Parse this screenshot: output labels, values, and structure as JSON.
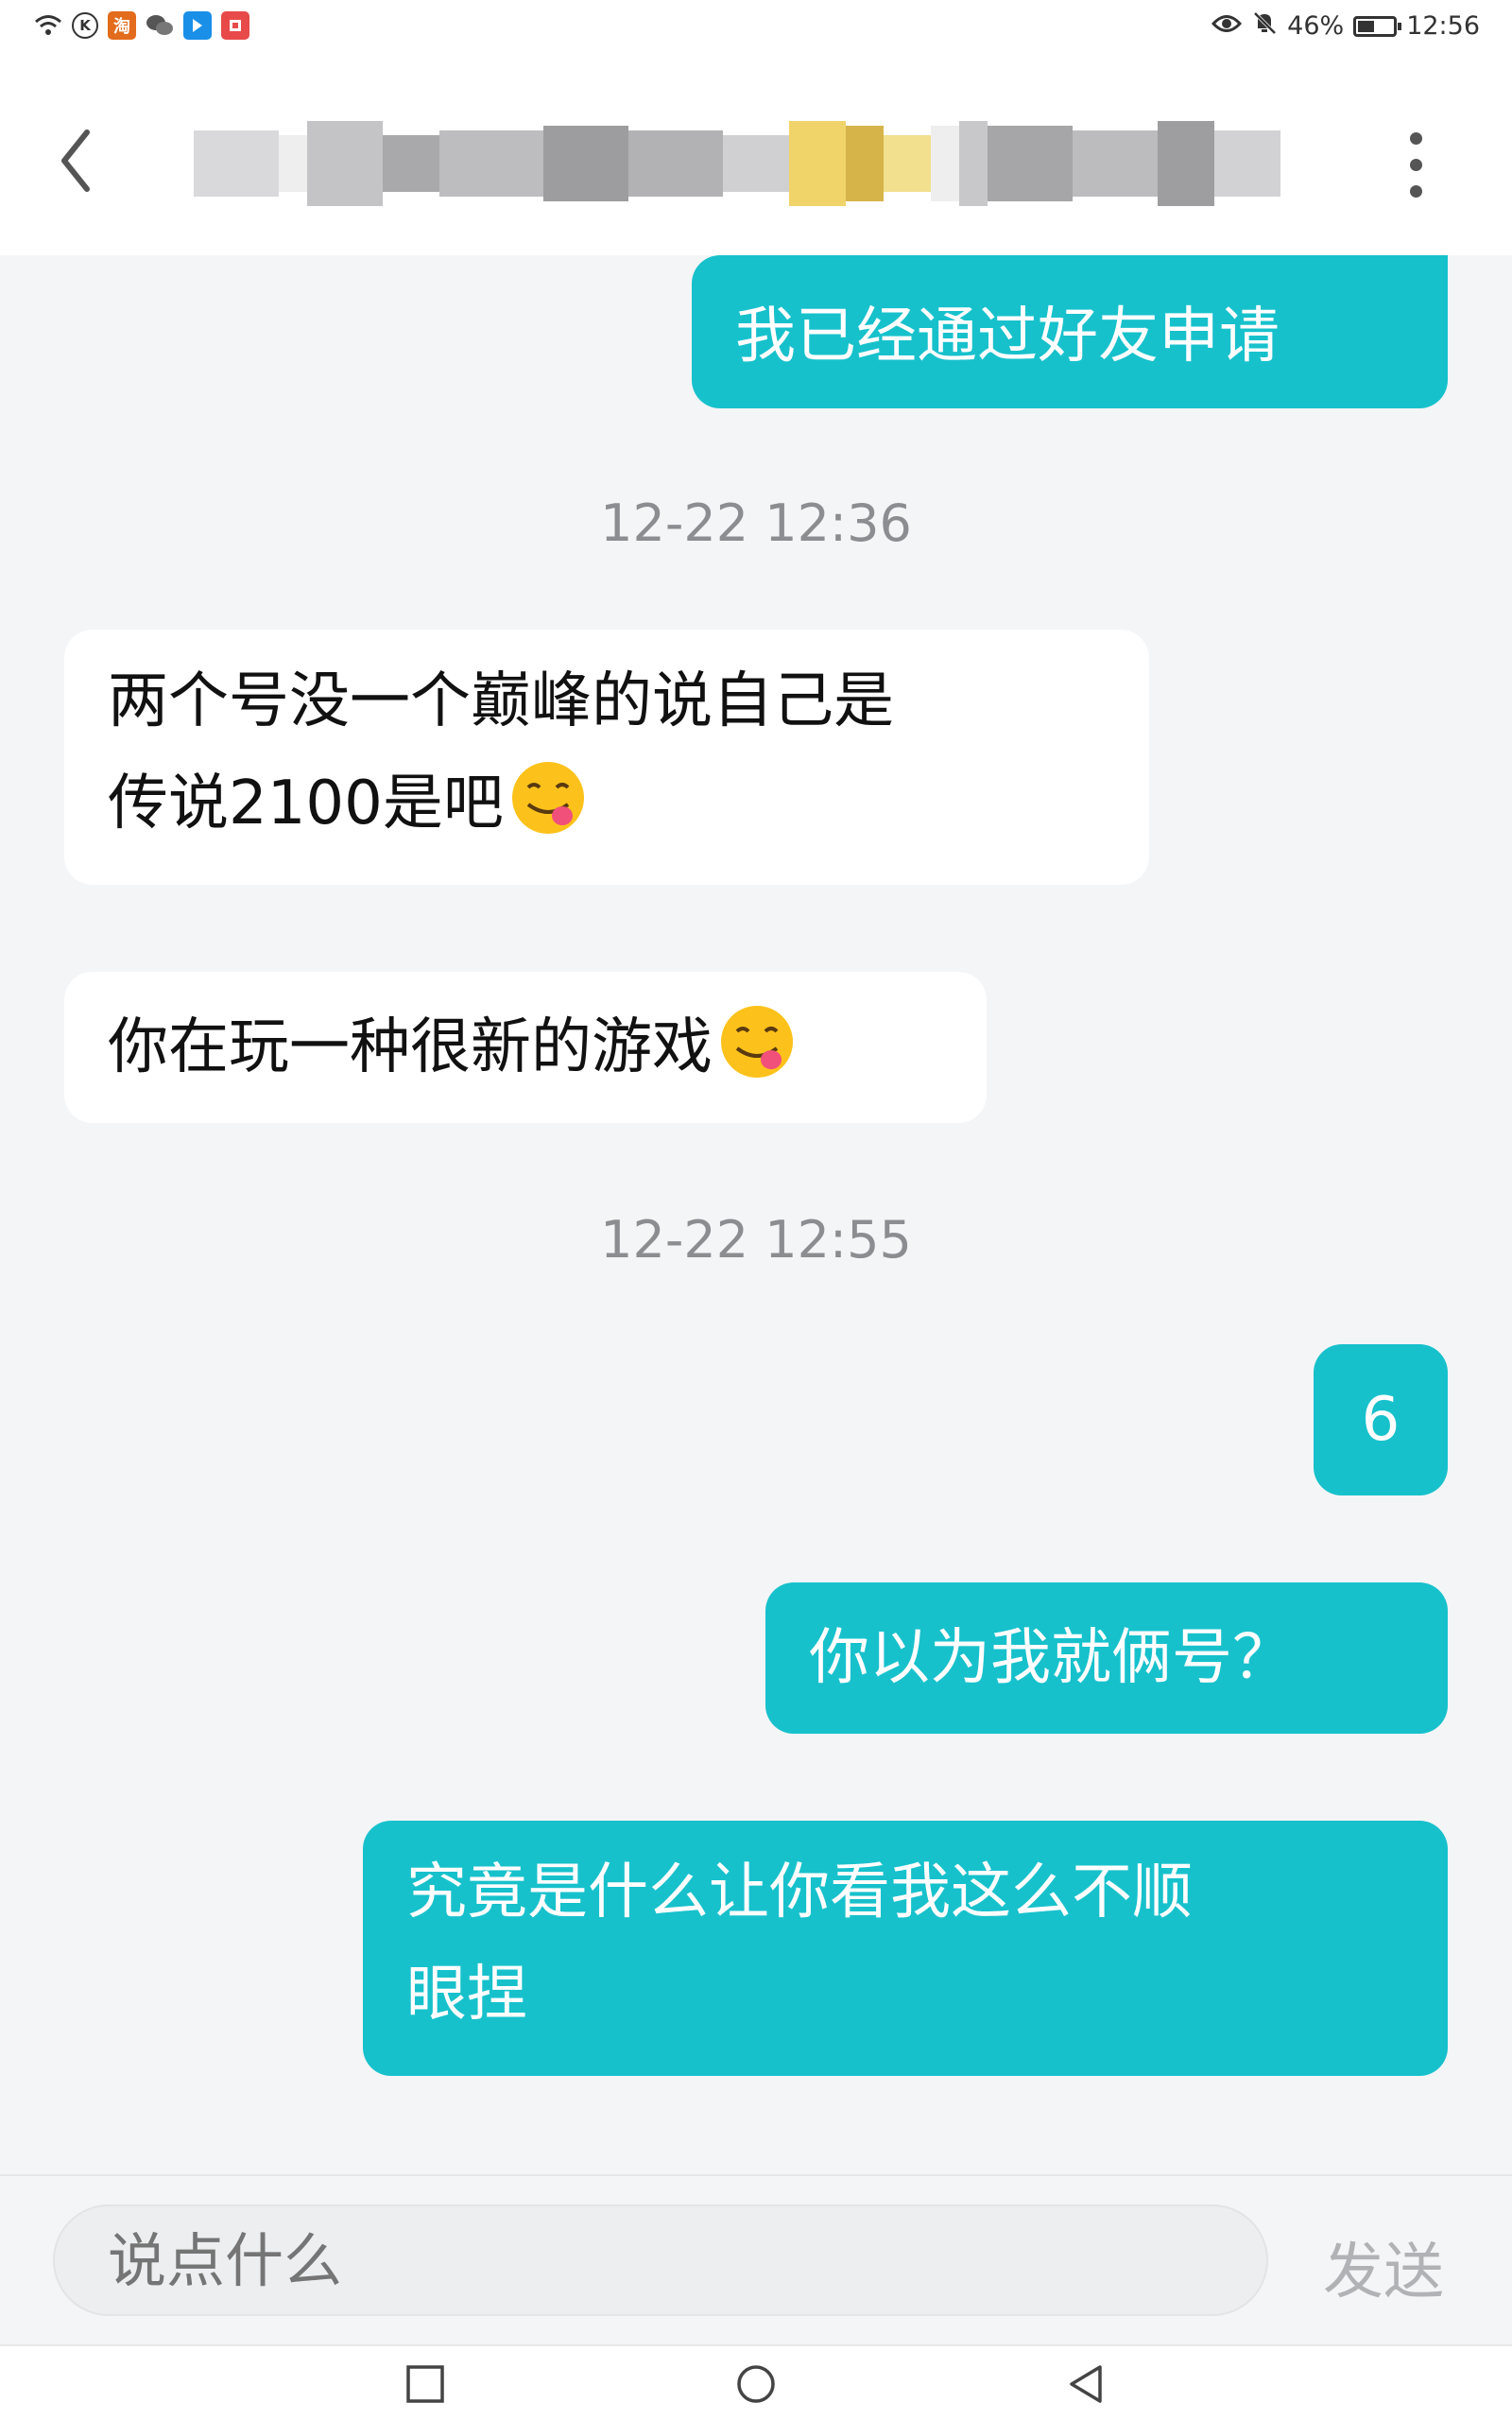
{
  "status_bar": {
    "left_icons": [
      "wifi-icon",
      "k-app-icon",
      "taobao-icon",
      "wechat-icon",
      "blue-app-icon",
      "red-app-icon"
    ],
    "taobao_label": "淘",
    "k_label": "K",
    "right_icons": [
      "eye-icon",
      "mute-bell-icon",
      "battery-icon"
    ],
    "battery": "46%",
    "battery_level": 0.46,
    "time": "12:56"
  },
  "header": {
    "title_blurred": true
  },
  "messages": [
    {
      "type": "outgoing",
      "text": "我已经通过好友申请"
    },
    {
      "type": "timestamp",
      "text": "12-22 12:36"
    },
    {
      "type": "incoming",
      "line1": "两个号没一个巅峰的说自己是",
      "line2": "传说2100是吧",
      "emoji": "savoring-face-emoji"
    },
    {
      "type": "incoming",
      "text": "你在玩一种很新的游戏",
      "emoji": "savoring-face-emoji"
    },
    {
      "type": "timestamp",
      "text": "12-22 12:55"
    },
    {
      "type": "outgoing",
      "text": "6"
    },
    {
      "type": "outgoing",
      "text": "你以为我就俩号？"
    },
    {
      "type": "outgoing",
      "line1": "究竟是什么让你看我这么不顺",
      "line2": "眼捏"
    }
  ],
  "input": {
    "placeholder": "说点什么",
    "value": "",
    "send_label": "发送"
  },
  "nav": {
    "items": [
      "recent-apps-icon",
      "home-icon",
      "back-icon"
    ]
  },
  "colors": {
    "outgoing_bubble": "#17c1cc",
    "incoming_bubble": "#ffffff",
    "background": "#f4f5f7",
    "timestamp": "#8b8d91"
  }
}
